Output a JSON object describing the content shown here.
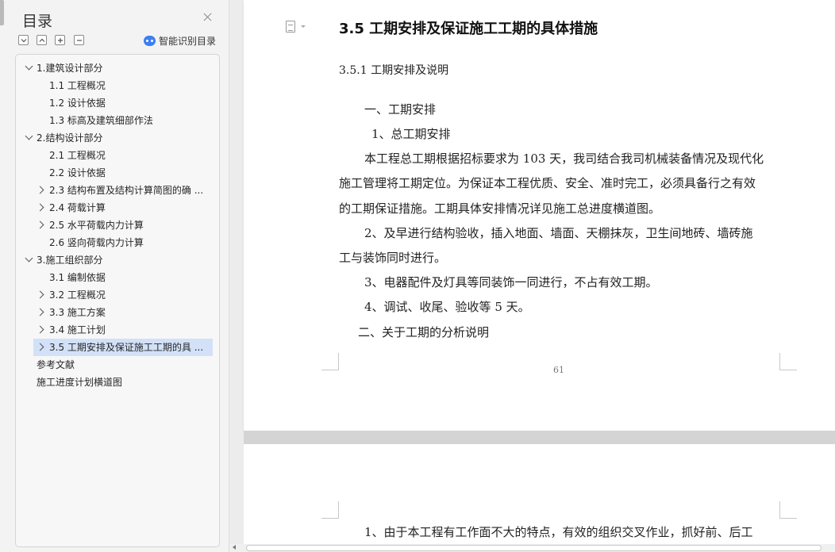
{
  "toc_pane": {
    "title": "目录",
    "smart_label": "智能识别目录",
    "items": [
      {
        "label": "1.建筑设计部分",
        "level": 1,
        "expander": "down"
      },
      {
        "label": "1.1 工程概况",
        "level": 2,
        "expander": "none"
      },
      {
        "label": "1.2 设计依据",
        "level": 2,
        "expander": "none"
      },
      {
        "label": "1.3 标高及建筑细部作法",
        "level": 2,
        "expander": "none"
      },
      {
        "label": "2.结构设计部分",
        "level": 1,
        "expander": "down"
      },
      {
        "label": "2.1 工程概况",
        "level": 2,
        "expander": "none"
      },
      {
        "label": "2.2 设计依据",
        "level": 2,
        "expander": "none"
      },
      {
        "label": "2.3 结构布置及结构计算简图的确 ...",
        "level": 2,
        "expander": "right"
      },
      {
        "label": "2.4 荷载计算",
        "level": 2,
        "expander": "right"
      },
      {
        "label": "2.5 水平荷载内力计算",
        "level": 2,
        "expander": "right"
      },
      {
        "label": "2.6 竖向荷载内力计算",
        "level": 2,
        "expander": "none"
      },
      {
        "label": "3.施工组织部分",
        "level": 1,
        "expander": "down"
      },
      {
        "label": "3.1 编制依据",
        "level": 2,
        "expander": "none"
      },
      {
        "label": "3.2 工程概况",
        "level": 2,
        "expander": "right"
      },
      {
        "label": "3.3 施工方案",
        "level": 2,
        "expander": "right"
      },
      {
        "label": "3.4 施工计划",
        "level": 2,
        "expander": "right"
      },
      {
        "label": "3.5 工期安排及保证施工工期的具 ...",
        "level": 2,
        "expander": "right",
        "selected": true
      },
      {
        "label": "参考文献",
        "level": 0,
        "expander": "none"
      },
      {
        "label": "施工进度计划横道图",
        "level": 0,
        "expander": "none"
      }
    ]
  },
  "document": {
    "heading": "3.5 工期安排及保证施工工期的具体措施",
    "subheading": "3.5.1 工期安排及说明",
    "lines": [
      "一、工期安排",
      "1、总工期安排",
      "本工程总工期根据招标要求为 103 天，我司结合我司机械装备情况及现代化",
      "施工管理将工期定位。为保证本工程优质、安全、准时完工，必须具备行之有效",
      "的工期保证措施。工期具体安排情况详见施工总进度横道图。",
      "2、及早进行结构验收，插入地面、墙面、天棚抹灰，卫生间地砖、墙砖施",
      "工与装饰同时进行。",
      "3、电器配件及灯具等同装饰一同进行，不占有效工期。",
      "4、调试、收尾、验收等 5 天。",
      "二、关于工期的分析说明"
    ],
    "page_number": "61",
    "page2_line": "1、由于本工程有工作面不大的特点，有效的组织交叉作业，抓好前、后工"
  },
  "colors": {
    "selection": "#d2e1f8",
    "accent": "#3d7ff0"
  }
}
